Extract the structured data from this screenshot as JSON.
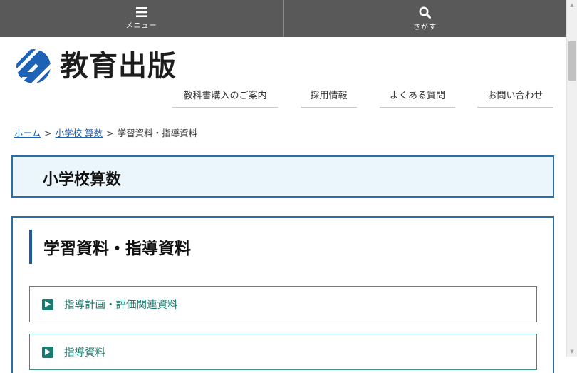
{
  "topbar": {
    "menu_label": "メニュー",
    "search_label": "さがす"
  },
  "logo": {
    "text": "教育出版"
  },
  "header_nav": {
    "items": [
      {
        "label": "教科書購入のご案内"
      },
      {
        "label": "採用情報"
      },
      {
        "label": "よくある質問"
      },
      {
        "label": "お問い合わせ"
      }
    ]
  },
  "breadcrumb": {
    "home": "ホーム",
    "sep": ">",
    "level2": "小学校 算数",
    "current": "学習資料・指導資料"
  },
  "page": {
    "title": "小学校算数",
    "section_title": "学習資料・指導資料",
    "links": [
      {
        "label": "指導計画・評価関連資料"
      },
      {
        "label": "指導資料"
      }
    ]
  },
  "colors": {
    "topbar": "#595959",
    "accent_blue": "#2a6da7",
    "title_bg": "#eaf6fb",
    "link_teal": "#1d7a6e",
    "breadcrumb_link": "#1a5fb4"
  },
  "icons": [
    "hamburger-icon",
    "search-icon",
    "logo-mark-icon",
    "play-icon"
  ]
}
